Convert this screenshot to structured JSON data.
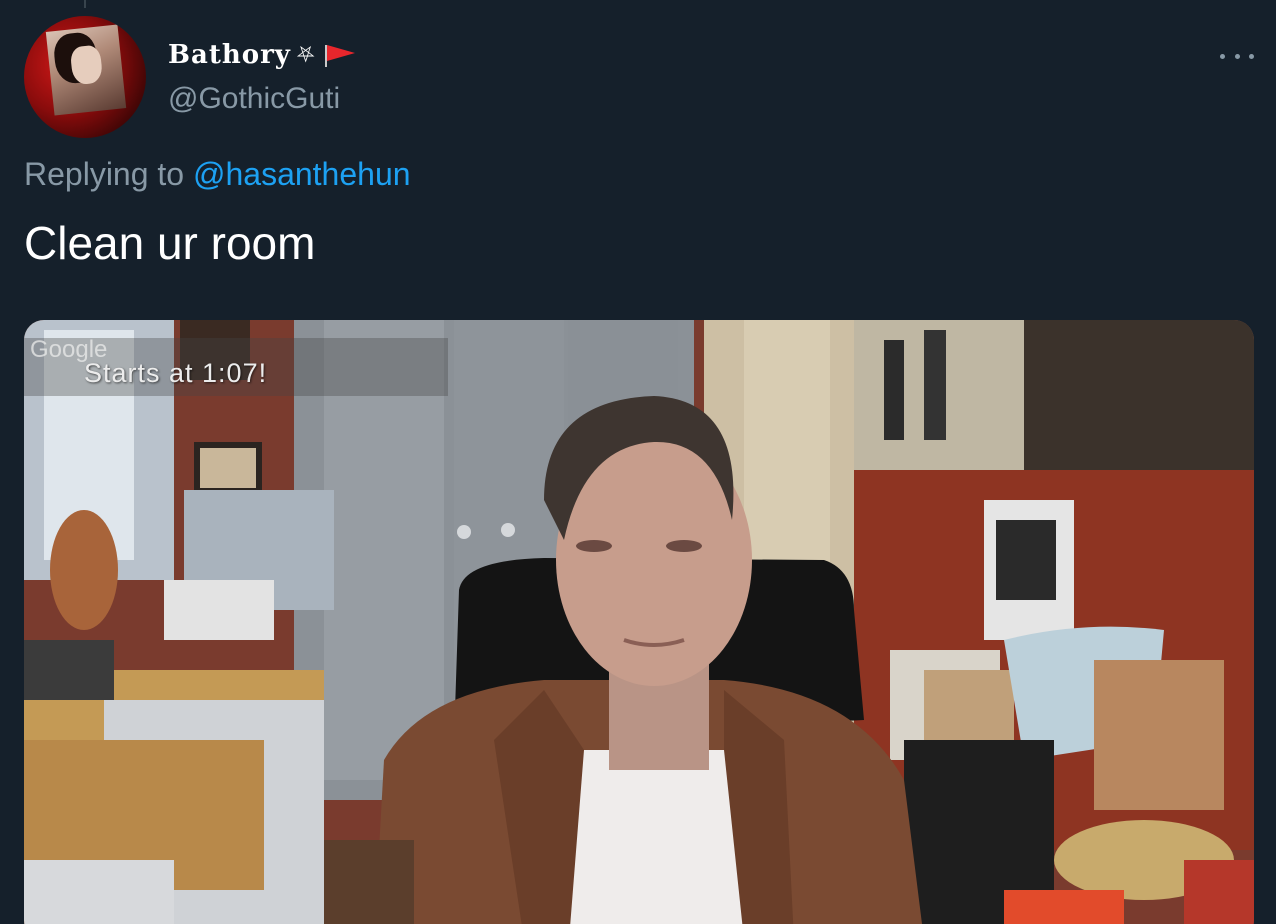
{
  "tweet": {
    "display_name": "Bathory",
    "name_emoji_pentagram": "⛧",
    "name_emoji_flag": "red-flag-icon",
    "handle": "@GothicGuti",
    "replying_prefix": "Replying to ",
    "replying_handle": "@hasanthehun",
    "text": "Clean ur room",
    "more_icon": "more-horizontal-icon"
  },
  "media": {
    "overlay_google": "Google",
    "overlay_caption": "Starts at 1:07!"
  },
  "colors": {
    "background": "#15202b",
    "secondary_text": "#8899a6",
    "link": "#1da1f2",
    "primary_text": "#ffffff"
  }
}
